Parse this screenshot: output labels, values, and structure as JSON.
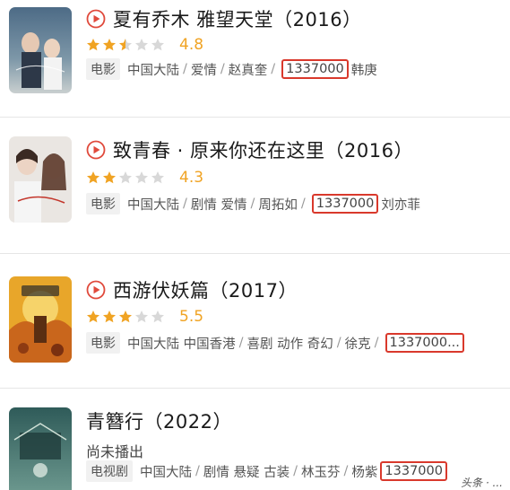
{
  "colors": {
    "star_filled": "#f0a323",
    "star_empty": "#d8d8d8",
    "highlight_box": "#d9392c",
    "play_icon": "#e04a3c"
  },
  "items": [
    {
      "title": "夏有乔木 雅望天堂（2016）",
      "has_play": true,
      "rating": 4.8,
      "rating_text": "4.8",
      "stars": [
        "full",
        "full",
        "half",
        "empty",
        "empty"
      ],
      "meta_tag": "电影",
      "meta_before": [
        "中国大陆",
        "爱情",
        "赵真奎"
      ],
      "highlight": "1337000",
      "meta_after": "韩庚"
    },
    {
      "title": "致青春 · 原来你还在这里（2016）",
      "has_play": true,
      "rating": 4.3,
      "rating_text": "4.3",
      "stars": [
        "full",
        "full",
        "empty",
        "empty",
        "empty"
      ],
      "meta_tag": "电影",
      "meta_before": [
        "中国大陆",
        "剧情 爱情",
        "周拓如"
      ],
      "highlight": "1337000",
      "meta_after": "刘亦菲"
    },
    {
      "title": "西游伏妖篇（2017）",
      "has_play": true,
      "rating": 5.5,
      "rating_text": "5.5",
      "stars": [
        "full",
        "full",
        "full",
        "empty",
        "empty"
      ],
      "meta_tag": "电影",
      "meta_before": [
        "中国大陆 中国香港",
        "喜剧 动作 奇幻",
        "徐克"
      ],
      "highlight": "1337000...",
      "meta_after": ""
    },
    {
      "title": "青簪行（2022）",
      "has_play": false,
      "status": "尚未播出",
      "meta_tag": "电视剧",
      "meta_before": [
        "中国大陆",
        "剧情 悬疑 古装",
        "林玉芬",
        "杨紫"
      ],
      "highlight": "1337000",
      "meta_after": ""
    }
  ],
  "watermark": "头条 · ..."
}
